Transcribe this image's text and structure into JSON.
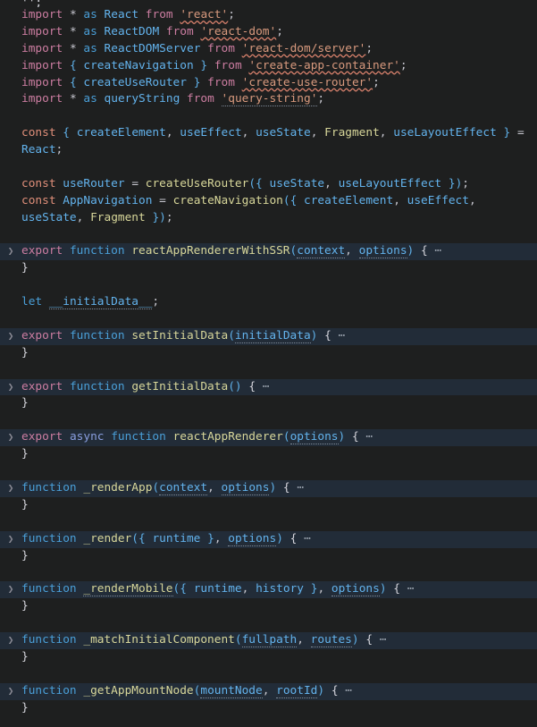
{
  "editor": {
    "background": "#1e1f1f",
    "fold_highlight": "#222c38",
    "language": "javascript",
    "fold_placeholder": "⋯",
    "fold_chevron": "❯"
  },
  "colors": {
    "keyword_export": "#cc7da1",
    "keyword_function": "#4a9fd8",
    "keyword_const": "#e08f7a",
    "function_name": "#d8d79a",
    "identifier": "#63b3ed",
    "string": "#d99a7e",
    "punctuation": "#c8c8d0",
    "error_squiggle": "#d6806b",
    "foreground": "#d6d6dd"
  },
  "lines": [
    {
      "n": 0,
      "type": "partial"
    },
    {
      "n": 1,
      "type": "code",
      "text": "import * as React from 'react';"
    },
    {
      "n": 2,
      "type": "code",
      "text": "import * as ReactDOM from 'react-dom';"
    },
    {
      "n": 3,
      "type": "code",
      "text": "import * as ReactDOMServer from 'react-dom/server';"
    },
    {
      "n": 4,
      "type": "code",
      "text": "import { createNavigation } from 'create-app-container';"
    },
    {
      "n": 5,
      "type": "code",
      "text": "import { createUseRouter } from 'create-use-router';"
    },
    {
      "n": 6,
      "type": "code",
      "text": "import * as queryString from 'query-string';"
    },
    {
      "n": 7,
      "type": "blank",
      "text": ""
    },
    {
      "n": 8,
      "type": "code",
      "text": "const { createElement, useEffect, useState, Fragment, useLayoutEffect } ="
    },
    {
      "n": 9,
      "type": "code",
      "text": "React;"
    },
    {
      "n": 10,
      "type": "blank",
      "text": ""
    },
    {
      "n": 11,
      "type": "code",
      "text": "const useRouter = createUseRouter({ useState, useLayoutEffect });"
    },
    {
      "n": 12,
      "type": "code",
      "text": "const AppNavigation = createNavigation({ createElement, useEffect,"
    },
    {
      "n": 13,
      "type": "code",
      "text": "useState, Fragment });"
    },
    {
      "n": 14,
      "type": "blank",
      "text": ""
    },
    {
      "n": 15,
      "type": "folded",
      "text": "export function reactAppRendererWithSSR(context, options) {"
    },
    {
      "n": 16,
      "type": "code",
      "text": "}"
    },
    {
      "n": 17,
      "type": "blank",
      "text": ""
    },
    {
      "n": 18,
      "type": "code",
      "text": "let __initialData__;"
    },
    {
      "n": 19,
      "type": "blank",
      "text": ""
    },
    {
      "n": 20,
      "type": "folded",
      "text": "export function setInitialData(initialData) {"
    },
    {
      "n": 21,
      "type": "code",
      "text": "}"
    },
    {
      "n": 22,
      "type": "blank",
      "text": ""
    },
    {
      "n": 23,
      "type": "folded",
      "text": "export function getInitialData() {"
    },
    {
      "n": 24,
      "type": "code",
      "text": "}"
    },
    {
      "n": 25,
      "type": "blank",
      "text": ""
    },
    {
      "n": 26,
      "type": "folded",
      "text": "export async function reactAppRenderer(options) {"
    },
    {
      "n": 27,
      "type": "code",
      "text": "}"
    },
    {
      "n": 28,
      "type": "blank",
      "text": ""
    },
    {
      "n": 29,
      "type": "folded",
      "text": "function _renderApp(context, options) {"
    },
    {
      "n": 30,
      "type": "code",
      "text": "}"
    },
    {
      "n": 31,
      "type": "blank",
      "text": ""
    },
    {
      "n": 32,
      "type": "folded",
      "text": "function _render({ runtime }, options) {"
    },
    {
      "n": 33,
      "type": "code",
      "text": "}"
    },
    {
      "n": 34,
      "type": "blank",
      "text": ""
    },
    {
      "n": 35,
      "type": "folded",
      "text": "function _renderMobile({ runtime, history }, options) {"
    },
    {
      "n": 36,
      "type": "code",
      "text": "}"
    },
    {
      "n": 37,
      "type": "blank",
      "text": ""
    },
    {
      "n": 38,
      "type": "folded",
      "text": "function _matchInitialComponent(fullpath, routes) {"
    },
    {
      "n": 39,
      "type": "code",
      "text": "}"
    },
    {
      "n": 40,
      "type": "blank",
      "text": ""
    },
    {
      "n": 41,
      "type": "folded",
      "text": "function _getAppMountNode(mountNode, rootId) {"
    },
    {
      "n": 42,
      "type": "code",
      "text": "}"
    }
  ],
  "tokens": {
    "import": "import",
    "star": "*",
    "as": "as",
    "from": "from",
    "export": "export",
    "async": "async",
    "function": "function",
    "const": "const",
    "let": "let",
    "semicolon": ";",
    "comma": ",",
    "equals": "=",
    "lbrace": "{",
    "rbrace": "}",
    "lparen": "(",
    "rparen": ")"
  },
  "modules": {
    "react": "'react'",
    "react_dom": "'react-dom'",
    "react_dom_server": "'react-dom/server'",
    "create_app_container": "'create-app-container'",
    "create_use_router": "'create-use-router'",
    "query_string": "'query-string'"
  },
  "identifiers": {
    "React": "React",
    "ReactDOM": "ReactDOM",
    "ReactDOMServer": "ReactDOMServer",
    "createNavigation": "createNavigation",
    "createUseRouter": "createUseRouter",
    "queryString": "queryString",
    "createElement": "createElement",
    "useEffect": "useEffect",
    "useState": "useState",
    "Fragment": "Fragment",
    "useLayoutEffect": "useLayoutEffect",
    "useRouter": "useRouter",
    "AppNavigation": "AppNavigation",
    "initialData_var": "__initialData__",
    "context": "context",
    "options": "options",
    "initialData": "initialData",
    "runtime": "runtime",
    "history": "history",
    "fullpath": "fullpath",
    "routes": "routes",
    "mountNode": "mountNode",
    "rootId": "rootId"
  },
  "functions": {
    "reactAppRendererWithSSR": "reactAppRendererWithSSR",
    "setInitialData": "setInitialData",
    "getInitialData": "getInitialData",
    "reactAppRenderer": "reactAppRenderer",
    "_renderApp": "_renderApp",
    "_render": "_render",
    "_renderMobile": "_renderMobile",
    "_matchInitialComponent": "_matchInitialComponent",
    "_getAppMountNode": "_getAppMountNode"
  }
}
